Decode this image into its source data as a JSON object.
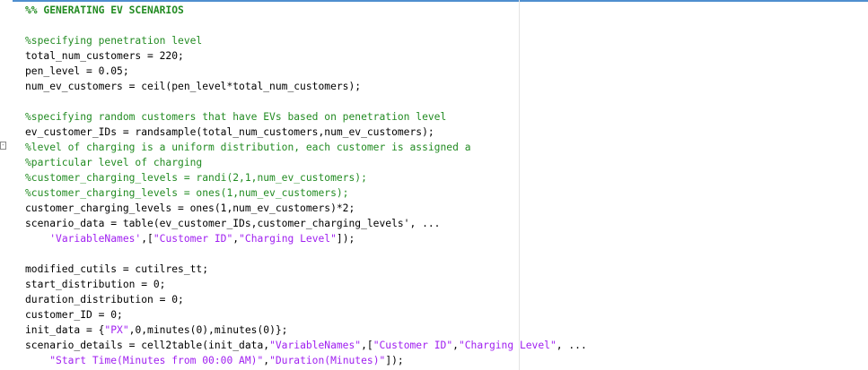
{
  "editor": {
    "lines": [
      [
        {
          "t": "%% GENERATING EV SCENARIOS",
          "k": "cb"
        }
      ],
      [],
      [
        {
          "t": "%specifying penetration level",
          "k": "c"
        }
      ],
      [
        {
          "t": "total_num_customers = 220;",
          "k": ""
        }
      ],
      [
        {
          "t": "pen_level = 0.05;",
          "k": ""
        }
      ],
      [
        {
          "t": "num_ev_customers = ceil(pen_level*total_num_customers);",
          "k": ""
        }
      ],
      [],
      [
        {
          "t": "%specifying random customers that have EVs based on penetration level",
          "k": "c"
        }
      ],
      [
        {
          "t": "ev_customer_IDs = randsample(total_num_customers,num_ev_customers);",
          "k": ""
        }
      ],
      [
        {
          "t": "%level of charging is a uniform distribution, each customer is assigned a",
          "k": "c"
        }
      ],
      [
        {
          "t": "%particular level of charging",
          "k": "c"
        }
      ],
      [
        {
          "t": "%customer_charging_levels = randi(2,1,num_ev_customers);",
          "k": "c"
        }
      ],
      [
        {
          "t": "%customer_charging_levels = ones(1,num_ev_customers);",
          "k": "c"
        }
      ],
      [
        {
          "t": "customer_charging_levels = ones(1,num_ev_customers)*2;",
          "k": ""
        }
      ],
      [
        {
          "t": "scenario_data = table(ev_customer_IDs,customer_charging_levels', ...",
          "k": ""
        }
      ],
      [
        {
          "t": "    ",
          "k": ""
        },
        {
          "t": "'VariableNames'",
          "k": "s"
        },
        {
          "t": ",[",
          "k": ""
        },
        {
          "t": "\"Customer ID\"",
          "k": "s"
        },
        {
          "t": ",",
          "k": ""
        },
        {
          "t": "\"Charging Level\"",
          "k": "s"
        },
        {
          "t": "]);",
          "k": ""
        }
      ],
      [],
      [
        {
          "t": "modified_cutils = cutilres_tt;",
          "k": ""
        }
      ],
      [
        {
          "t": "start_distribution = 0;",
          "k": ""
        }
      ],
      [
        {
          "t": "duration_distribution = 0;",
          "k": ""
        }
      ],
      [
        {
          "t": "customer_ID = 0;",
          "k": ""
        }
      ],
      [
        {
          "t": "init_data = {",
          "k": ""
        },
        {
          "t": "\"PX\"",
          "k": "s"
        },
        {
          "t": ",0,minutes(0),minutes(0)};",
          "k": ""
        }
      ],
      [
        {
          "t": "scenario_details = cell2table(init_data,",
          "k": ""
        },
        {
          "t": "\"VariableNames\"",
          "k": "s"
        },
        {
          "t": ",[",
          "k": ""
        },
        {
          "t": "\"Customer ID\"",
          "k": "s"
        },
        {
          "t": ",",
          "k": ""
        },
        {
          "t": "\"Charging Level\"",
          "k": "s"
        },
        {
          "t": ", ...",
          "k": ""
        }
      ],
      [
        {
          "t": "    ",
          "k": ""
        },
        {
          "t": "\"Start Time(Minutes from 00:00 AM)\"",
          "k": "s"
        },
        {
          "t": ",",
          "k": ""
        },
        {
          "t": "\"Duration(Minutes)\"",
          "k": "s"
        },
        {
          "t": "]);",
          "k": ""
        }
      ]
    ],
    "fold_marker": "-",
    "colors": {
      "code": "#000000",
      "comment": "#228b22",
      "string": "#a020f0",
      "accent_line": "#4f8fcf"
    }
  }
}
